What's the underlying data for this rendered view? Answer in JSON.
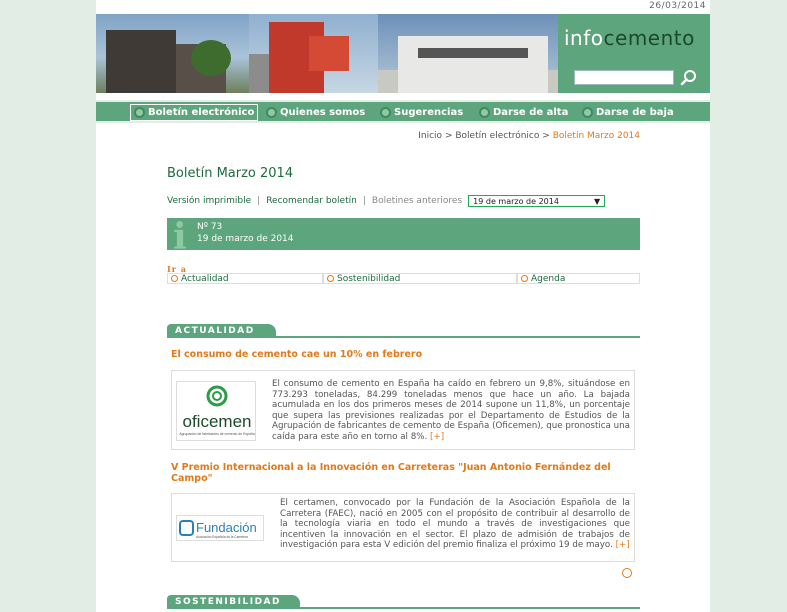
{
  "header": {
    "date": "26/03/2014",
    "logo_light": "info",
    "logo_bold": "cemento",
    "search": {
      "value": "",
      "placeholder": ""
    }
  },
  "nav": [
    {
      "label": "Boletín electrónico",
      "active": true
    },
    {
      "label": "Quienes somos"
    },
    {
      "label": "Sugerencias"
    },
    {
      "label": "Darse de alta"
    },
    {
      "label": "Darse de baja"
    }
  ],
  "breadcrumb": {
    "home": "Inicio",
    "sep": ">",
    "parent": "Boletín electrónico",
    "current": "Boletín Marzo 2014"
  },
  "page_title": "Boletín Marzo 2014",
  "toolbar": {
    "print": "Versión imprimible",
    "recommend": "Recomendar boletín",
    "previous": "Boletines anteriores",
    "select_value": "19 de marzo de 2014"
  },
  "issue": {
    "number": "Nº 73",
    "date": "19 de marzo de 2014"
  },
  "goto": {
    "label": "Ir a",
    "links": [
      "Actualidad",
      "Sostenibilidad",
      "Agenda"
    ]
  },
  "sections": {
    "actualidad": {
      "title": "ACTUALIDAD",
      "news": [
        {
          "title": "El consumo de cemento cae un 10% en febrero",
          "logo_text": "oficemen",
          "logo_sub": "Agrupación de fabricantes de cemento de España",
          "text": "El consumo de cemento en España ha caído en febrero un 9,8%, situándose en 773.293 toneladas, 84.299 toneladas menos que hace un año. La bajada acumulada en los dos primeros meses de 2014 supone un 11,8%, un porcentaje que supera las previsiones realizadas por el Departamento de Estudios de la Agrupación de fabricantes de cemento de España (Oficemen), que pronostica una caída para este año en torno al 8%.",
          "more": "[+]"
        },
        {
          "title": "V Premio Internacional a la Innovación en Carreteras \"Juan Antonio Fernández del Campo\"",
          "logo_text": "Fundación",
          "logo_sub": "Asociación Española de la Carretera",
          "text": "El certamen, convocado por la Fundación de la Asociación Española de la Carretera (FAEC), nació en 2005 con el propósito de contribuir al desarrollo de la tecnología viaria en todo el mundo a través de investigaciones que incentiven la innovación en el sector. El plazo de admisión de trabajos de investigación para esta V edición del premio finaliza el próximo 19 de mayo.",
          "more": "[+]"
        }
      ]
    },
    "sostenibilidad": {
      "title": "SOSTENIBILIDAD"
    }
  },
  "colors": {
    "green": "#5da57c",
    "dark_green": "#1d6b3e",
    "orange": "#e07a1a",
    "background": "#e2ede6"
  }
}
